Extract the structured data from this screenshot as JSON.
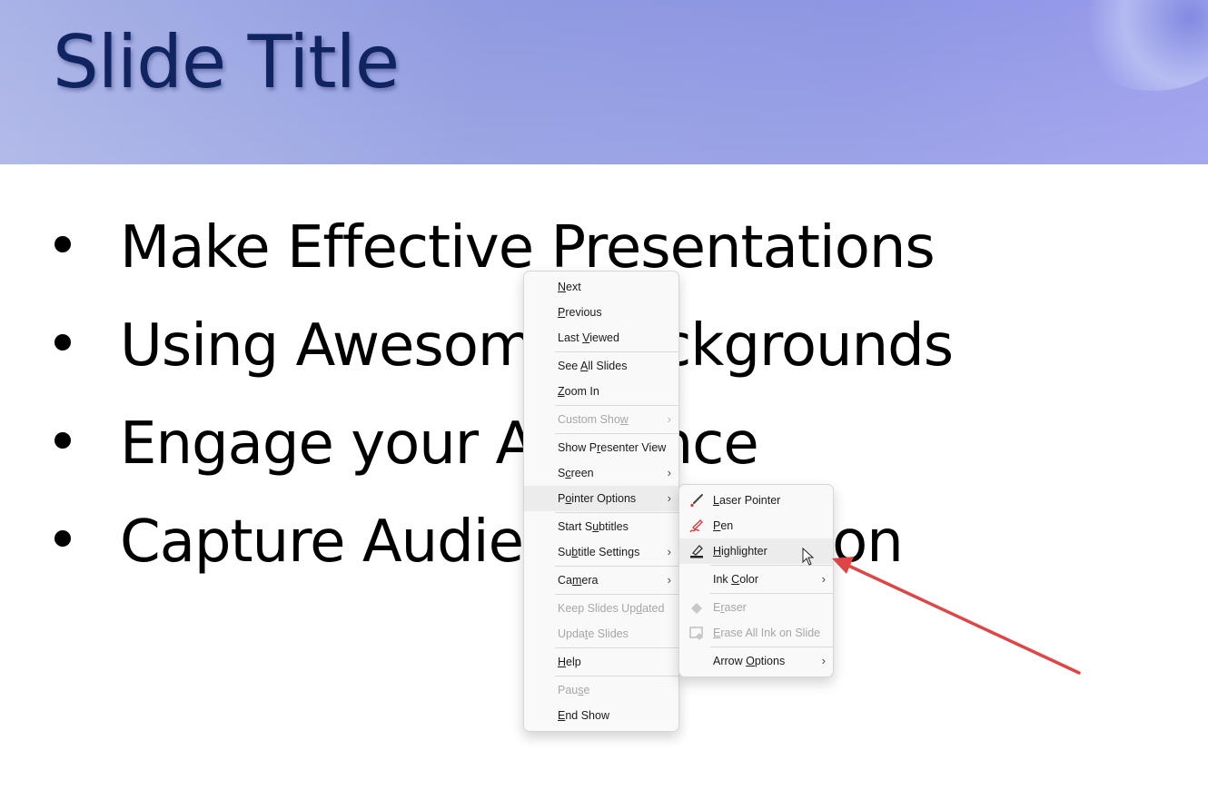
{
  "slide": {
    "title": "Slide Title",
    "bullets": [
      "Make Effective Presentations",
      "Using Awesome Backgrounds",
      "Engage your Audience",
      "Capture Audience Attention"
    ]
  },
  "context_menu": {
    "items": [
      {
        "label_pre": "",
        "accel": "N",
        "label_post": "ext",
        "disabled": false,
        "submenu": false
      },
      {
        "label_pre": "",
        "accel": "P",
        "label_post": "revious",
        "disabled": false,
        "submenu": false
      },
      {
        "label_pre": "Last ",
        "accel": "V",
        "label_post": "iewed",
        "disabled": false,
        "submenu": false
      },
      {
        "label_pre": "See ",
        "accel": "A",
        "label_post": "ll Slides",
        "disabled": false,
        "submenu": false
      },
      {
        "label_pre": "",
        "accel": "Z",
        "label_post": "oom In",
        "disabled": false,
        "submenu": false
      },
      {
        "label_pre": "Custom Sho",
        "accel": "w",
        "label_post": "",
        "disabled": true,
        "submenu": true
      },
      {
        "label_pre": "Show P",
        "accel": "r",
        "label_post": "esenter View",
        "disabled": false,
        "submenu": false
      },
      {
        "label_pre": "S",
        "accel": "c",
        "label_post": "reen",
        "disabled": false,
        "submenu": true
      },
      {
        "label_pre": "P",
        "accel": "o",
        "label_post": "inter Options",
        "disabled": false,
        "submenu": true,
        "hover": true
      },
      {
        "label_pre": "Start S",
        "accel": "u",
        "label_post": "btitles",
        "disabled": false,
        "submenu": false
      },
      {
        "label_pre": "Su",
        "accel": "b",
        "label_post": "title Settings",
        "disabled": false,
        "submenu": true
      },
      {
        "label_pre": "Ca",
        "accel": "m",
        "label_post": "era",
        "disabled": false,
        "submenu": true
      },
      {
        "label_pre": "Keep Slides Up",
        "accel": "d",
        "label_post": "ated",
        "disabled": true,
        "submenu": false
      },
      {
        "label_pre": "Upda",
        "accel": "t",
        "label_post": "e Slides",
        "disabled": true,
        "submenu": false
      },
      {
        "label_pre": "",
        "accel": "H",
        "label_post": "elp",
        "disabled": false,
        "submenu": false
      },
      {
        "label_pre": "Pau",
        "accel": "s",
        "label_post": "e",
        "disabled": true,
        "submenu": false
      },
      {
        "label_pre": "",
        "accel": "E",
        "label_post": "nd Show",
        "disabled": false,
        "submenu": false
      }
    ]
  },
  "pointer_submenu": {
    "items": [
      {
        "icon": "laser-pointer-icon",
        "label_pre": "",
        "accel": "L",
        "label_post": "aser Pointer",
        "disabled": false,
        "submenu": false
      },
      {
        "icon": "pen-icon",
        "label_pre": "",
        "accel": "P",
        "label_post": "en",
        "disabled": false,
        "submenu": false
      },
      {
        "icon": "highlighter-icon",
        "label_pre": "",
        "accel": "H",
        "label_post": "ighlighter",
        "disabled": false,
        "submenu": false,
        "hover": true
      },
      {
        "icon": "",
        "label_pre": "Ink ",
        "accel": "C",
        "label_post": "olor",
        "disabled": false,
        "submenu": true
      },
      {
        "icon": "eraser-icon",
        "label_pre": "E",
        "accel": "r",
        "label_post": "aser",
        "disabled": true,
        "submenu": false
      },
      {
        "icon": "erase-all-ink-icon",
        "label_pre": "",
        "accel": "E",
        "label_post": "rase All Ink on Slide",
        "disabled": true,
        "submenu": false
      },
      {
        "icon": "",
        "label_pre": "Arrow ",
        "accel": "O",
        "label_post": "ptions",
        "disabled": false,
        "submenu": true
      }
    ]
  },
  "colors": {
    "title": "#0f2461",
    "annotation_arrow": "#e04545",
    "ink_red": "#e03030"
  }
}
